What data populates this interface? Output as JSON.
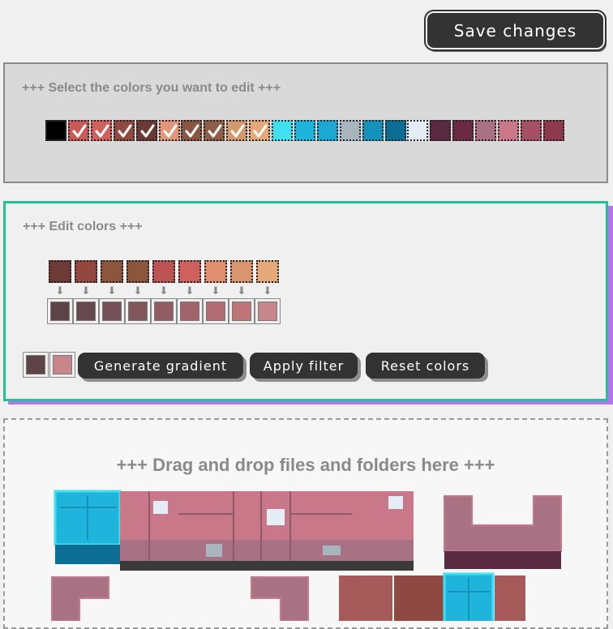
{
  "toolbar": {
    "save_label": "Save changes"
  },
  "select_section": {
    "heading": "+++ Select the colors you want to edit +++",
    "colors": [
      {
        "hex": "#000000",
        "checked": false
      },
      {
        "hex": "#c85a5a",
        "checked": true
      },
      {
        "hex": "#d0605e",
        "checked": true
      },
      {
        "hex": "#8f4a42",
        "checked": true
      },
      {
        "hex": "#6a3a35",
        "checked": true
      },
      {
        "hex": "#e0967a",
        "checked": true
      },
      {
        "hex": "#8a5542",
        "checked": true
      },
      {
        "hex": "#8e5e48",
        "checked": true
      },
      {
        "hex": "#d4996e",
        "checked": true
      },
      {
        "hex": "#e5a878",
        "checked": true
      },
      {
        "hex": "#40e0f0",
        "checked": false
      },
      {
        "hex": "#1fb4dc",
        "checked": false
      },
      {
        "hex": "#1aa8d4",
        "checked": false
      },
      {
        "hex": "#a8b4be",
        "checked": false
      },
      {
        "hex": "#1592bc",
        "checked": false
      },
      {
        "hex": "#0c6e94",
        "checked": false
      },
      {
        "hex": "#e4ecf6",
        "checked": false
      },
      {
        "hex": "#5a2a42",
        "checked": false
      },
      {
        "hex": "#6a2a44",
        "checked": false
      },
      {
        "hex": "#a87284",
        "checked": false
      },
      {
        "hex": "#c87888",
        "checked": false
      },
      {
        "hex": "#a65064",
        "checked": false
      },
      {
        "hex": "#8e3a4e",
        "checked": false
      }
    ]
  },
  "edit_section": {
    "heading": "+++ Edit colors +++",
    "source_colors": [
      "#6e3a36",
      "#94473f",
      "#8c553e",
      "#8c553e",
      "#bd5454",
      "#cf605e",
      "#e09070",
      "#d9966e",
      "#e5a878"
    ],
    "target_colors": [
      "#5e4447",
      "#684a4e",
      "#755056",
      "#82575c",
      "#925d62",
      "#a2646a",
      "#b26c72",
      "#bf7478",
      "#c8868a"
    ],
    "gradient_start": "#5e4447",
    "gradient_end": "#c8868a",
    "generate_label": "Generate gradient",
    "filter_label": "Apply filter",
    "reset_label": "Reset colors"
  },
  "drop_section": {
    "text": "+++ Drag and drop files and folders here +++"
  }
}
